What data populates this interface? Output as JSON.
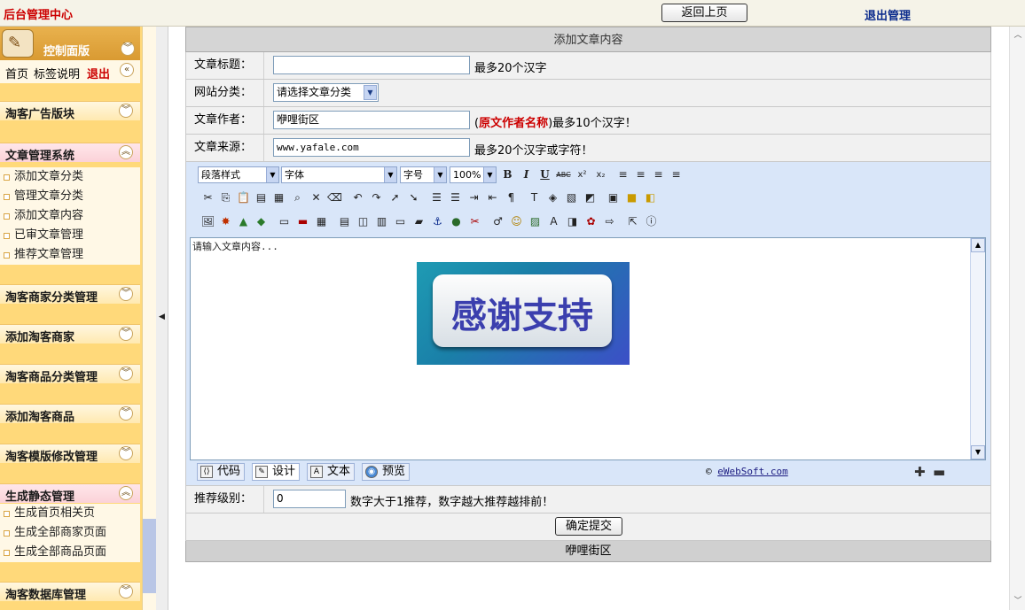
{
  "topbar": {
    "brand": "后台管理中心",
    "back_label": "返回上页",
    "logout_label": "退出管理"
  },
  "sidebar": {
    "panel_title": "控制面版",
    "quick_links": {
      "home": "首页",
      "tags": "标签说明",
      "logout": "退出"
    },
    "sections": [
      {
        "label": "淘客广告版块",
        "expanded": false,
        "items": []
      },
      {
        "label": "文章管理系统",
        "expanded": true,
        "items": [
          "添加文章分类",
          "管理文章分类",
          "添加文章内容",
          "已审文章管理",
          "推荐文章管理"
        ]
      },
      {
        "label": "淘客商家分类管理",
        "expanded": false,
        "items": []
      },
      {
        "label": "添加淘客商家",
        "expanded": false,
        "items": []
      },
      {
        "label": "淘客商品分类管理",
        "expanded": false,
        "items": []
      },
      {
        "label": "添加淘客商品",
        "expanded": false,
        "items": []
      },
      {
        "label": "淘客模版修改管理",
        "expanded": false,
        "items": []
      },
      {
        "label": "生成静态管理",
        "expanded": true,
        "items": [
          "生成首页相关页",
          "生成全部商家页面",
          "生成全部商品页面"
        ]
      },
      {
        "label": "淘客数据库管理",
        "expanded": false,
        "items": []
      }
    ]
  },
  "form": {
    "header": "添加文章内容",
    "title": {
      "label": "文章标题：",
      "value": "",
      "note": "最多20个汉字"
    },
    "category": {
      "label": "网站分类：",
      "selected": "请选择文章分类"
    },
    "author": {
      "label": "文章作者：",
      "value": "咿哩街区",
      "note_prefix": "(",
      "note_bold": "原文作者名称",
      "note_suffix": ")最多10个汉字！"
    },
    "source": {
      "label": "文章来源：",
      "value": "www.yafale.com",
      "note": "最多20个汉字或字符！"
    },
    "editor": {
      "paragraph_style": "段落样式",
      "font": "字体",
      "font_size": "字号",
      "zoom": "100%",
      "placeholder": "请输入文章内容...",
      "banner_text": "感谢支持",
      "modes": [
        "代码",
        "设计",
        "文本",
        "预览"
      ],
      "active_mode": "设计",
      "copyright_symbol": "©",
      "copyright_link": "eWebSoft.com"
    },
    "priority": {
      "label": "推荐级别：",
      "value": "0",
      "note": "数字大于1推荐，数字越大推荐越排前！"
    },
    "submit_label": "确定提交",
    "footer": "咿哩街区"
  }
}
